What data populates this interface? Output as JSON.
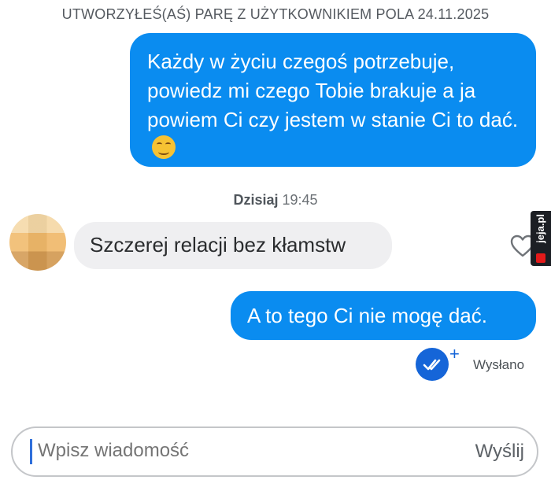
{
  "match_header": "UTWORZYŁEŚ(AŚ) PARĘ Z UŻYTKOWNIKIEM POLA 24.11.2025",
  "messages": [
    {
      "direction": "outgoing",
      "text": "Każdy w życiu czegoś potrzebuje, powiedz mi czego Tobie brakuje a ja powiem Ci czy jestem w stanie Ci to dać.",
      "emoji": "smirking-face"
    },
    {
      "direction": "incoming",
      "text": "Szczerej relacji bez kłamstw"
    },
    {
      "direction": "outgoing",
      "text": "A to tego Ci nie mogę dać."
    }
  ],
  "timestamp": {
    "day": "Dzisiaj",
    "time": "19:45"
  },
  "status": {
    "plus": "+",
    "label": "Wysłano"
  },
  "composer": {
    "placeholder": "Wpisz wiadomość",
    "send_label": "Wyślij"
  },
  "watermark": "jeja.pl",
  "colors": {
    "outgoing_bubble": "#0a8cf0",
    "incoming_bubble": "#efeff1",
    "read_receipt": "#1565d8"
  }
}
